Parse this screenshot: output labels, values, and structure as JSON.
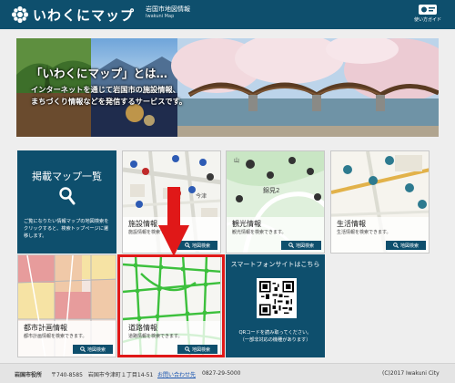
{
  "header": {
    "title": "いわくにマップ",
    "subtitle_ja": "岩国市地図情報",
    "subtitle_en": "Iwakuni Map",
    "guide_label": "使い方ガイド"
  },
  "hero": {
    "title": "「いわくにマップ」とは…",
    "line1": "インターネットを通じて岩国市の施設情報、",
    "line2": "まちづくり情報などを発信するサービスです。"
  },
  "tiles": {
    "list": {
      "title": "掲載マップ一覧",
      "desc": "ご覧になりたい情報マップの地図検索をクリックすると、検索トップページに遷移します。",
      "icon": "search-icon"
    },
    "facility": {
      "name": "施設情報",
      "desc": "施設情報を検索できます。",
      "button": "地図検索"
    },
    "tourism": {
      "name": "観光情報",
      "desc": "観光情報を検索できます。",
      "button": "地図検索"
    },
    "living": {
      "name": "生活情報",
      "desc": "生活情報を検索できます。",
      "button": "地図検索"
    },
    "urban": {
      "name": "都市計画情報",
      "desc": "都市計画情報を検索できます。",
      "button": "地図検索"
    },
    "road": {
      "name": "道路情報",
      "desc": "道路情報を検索できます。",
      "button": "地図検索"
    },
    "smartphone": {
      "title": "スマートフォンサイトはこちら",
      "line1": "QRコードを読み取ってください。",
      "line2": "（一部非対応の機種があります）"
    }
  },
  "map_labels": {
    "facility_town": "今津",
    "tourism_place": "錦見2",
    "tourism_mountain": "山"
  },
  "footer": {
    "org": "岩国市役所",
    "address": "〒740-8585　岩国市今津町１丁目14-51",
    "contact": "お問い合わせ先",
    "phone": "0827-29-5000",
    "copyright": "(C)2017 Iwakuni City"
  },
  "colors": {
    "header": "#0e4f6d",
    "highlight": "#e01818",
    "background": "#eeeeee"
  }
}
